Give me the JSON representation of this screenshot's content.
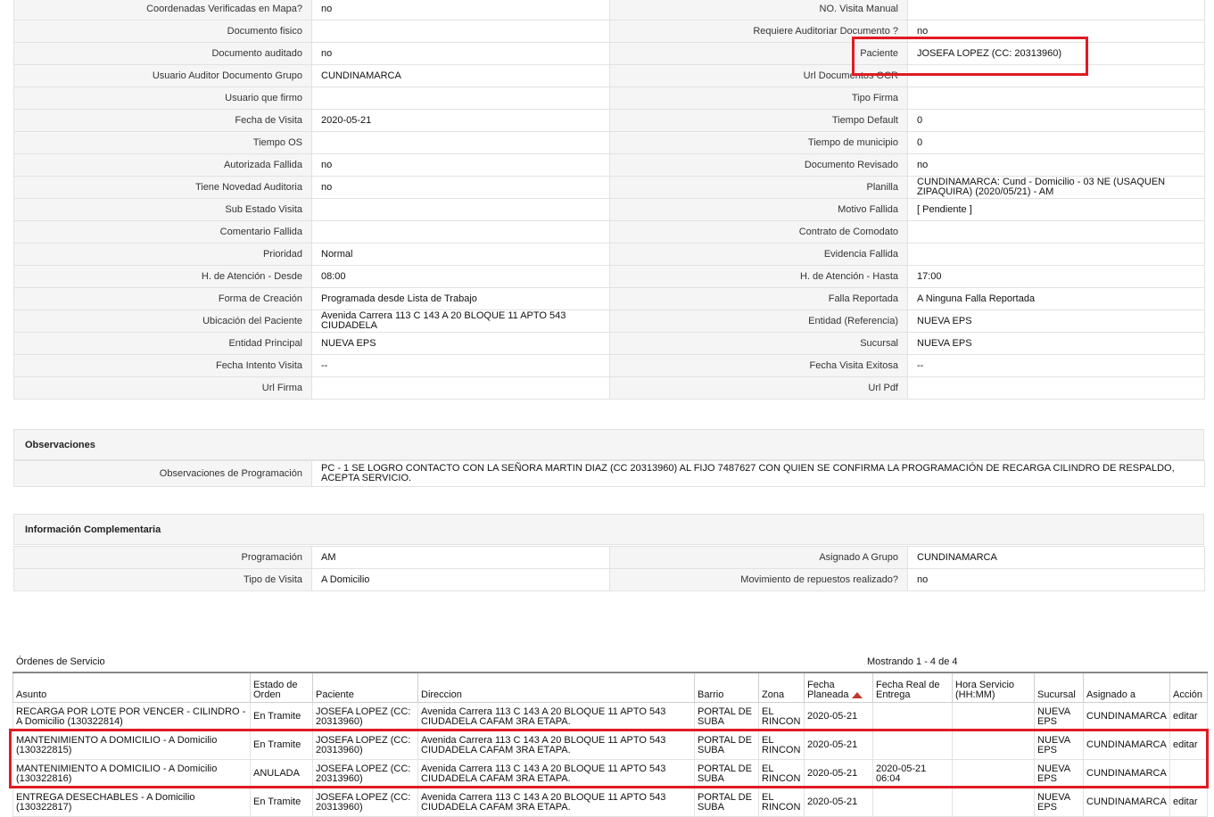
{
  "details": {
    "rows": [
      [
        "Coordenadas Verificadas en Mapa?",
        "no",
        "NO. Visita Manual",
        ""
      ],
      [
        "Documento fisico",
        "",
        "Requiere Auditoriar Documento ?",
        "no"
      ],
      [
        "Documento auditado",
        "no",
        "Paciente",
        "JOSEFA LOPEZ (CC: 20313960)"
      ],
      [
        "Usuario Auditor Documento Grupo",
        "CUNDINAMARCA",
        "Url Documentos OCR",
        ""
      ],
      [
        "Usuario que firmo",
        "",
        "Tipo Firma",
        ""
      ],
      [
        "Fecha de Visita",
        "2020-05-21",
        "Tiempo Default",
        "0"
      ],
      [
        "Tiempo OS",
        "",
        "Tiempo de municipio",
        "0"
      ],
      [
        "Autorizada Fallida",
        "no",
        "Documento Revisado",
        "no"
      ],
      [
        "Tiene Novedad Auditoria",
        "no",
        "Planilla",
        "CUNDINAMARCA: Cund - Domicilio - 03 NE (USAQUEN ZIPAQUIRA) (2020/05/21) - AM"
      ],
      [
        "Sub Estado Visita",
        "",
        "Motivo Fallida",
        "[ Pendiente ]"
      ],
      [
        "Comentario Fallida",
        "",
        "Contrato de Comodato",
        ""
      ],
      [
        "Prioridad",
        "Normal",
        "Evidencia Fallida",
        ""
      ],
      [
        "H. de Atención - Desde",
        "08:00",
        "H. de Atención - Hasta",
        "17:00"
      ],
      [
        "Forma de Creación",
        "Programada desde Lista de Trabajo",
        "Falla Reportada",
        "A Ninguna Falla Reportada"
      ],
      [
        "Ubicación del Paciente",
        "Avenida Carrera 113 C 143 A 20 BLOQUE 11 APTO 543 CIUDADELA",
        "Entidad (Referencia)",
        "NUEVA EPS"
      ],
      [
        "Entidad Principal",
        "NUEVA EPS",
        "Sucursal",
        "NUEVA EPS"
      ],
      [
        "Fecha Intento Visita",
        "--",
        "Fecha Visita Exitosa",
        "--"
      ],
      [
        "Url Firma",
        "",
        "Url Pdf",
        ""
      ]
    ]
  },
  "observaciones": {
    "title": "Observaciones",
    "label": "Observaciones de Programación",
    "value": "PC - 1 SE LOGRO CONTACTO CON LA SEÑORA MARTIN DIAZ (CC 20313960) AL FIJO 7487627 CON QUIEN SE CONFIRMA LA PROGRAMACIÓN DE RECARGA CILINDRO DE RESPALDO, ACEPTA SERVICIO."
  },
  "complementaria": {
    "title": "Información Complementaria",
    "rows": [
      [
        "Programación",
        "AM",
        "Asignado A Grupo",
        "CUNDINAMARCA"
      ],
      [
        "Tipo de Visita",
        "A Domicilio",
        "Movimiento de repuestos realizado?",
        "no"
      ]
    ]
  },
  "orders": {
    "title": "Órdenes de Servicio",
    "count_text": "Mostrando 1 - 4 de 4",
    "headers": [
      "Asunto",
      "Estado de Orden",
      "Paciente",
      "Direccion",
      "Barrio",
      "Zona",
      "Fecha Planeada",
      "Fecha Real de Entrega",
      "Hora Servicio (HH:MM)",
      "Sucursal",
      "Asignado a",
      "Acción"
    ],
    "rows": [
      [
        "RECARGA POR LOTE POR VENCER - CILINDRO - A Domicilio (130322814)",
        "En Tramite",
        "JOSEFA LOPEZ (CC: 20313960)",
        "Avenida Carrera 113 C 143 A 20 BLOQUE 11 APTO 543 CIUDADELA CAFAM 3RA ETAPA.",
        "PORTAL DE SUBA",
        "EL RINCON",
        "2020-05-21",
        "",
        "",
        "NUEVA EPS",
        "CUNDINAMARCA",
        "editar"
      ],
      [
        "MANTENIMIENTO A DOMICILIO - A Domicilio (130322815)",
        "En Tramite",
        "JOSEFA LOPEZ (CC: 20313960)",
        "Avenida Carrera 113 C 143 A 20 BLOQUE 11 APTO 543 CIUDADELA CAFAM 3RA ETAPA.",
        "PORTAL DE SUBA",
        "EL RINCON",
        "2020-05-21",
        "",
        "",
        "NUEVA EPS",
        "CUNDINAMARCA",
        "editar"
      ],
      [
        "MANTENIMIENTO A DOMICILIO - A Domicilio (130322816)",
        "ANULADA",
        "JOSEFA LOPEZ (CC: 20313960)",
        "Avenida Carrera 113 C 143 A 20 BLOQUE 11 APTO 543 CIUDADELA CAFAM 3RA ETAPA.",
        "PORTAL DE SUBA",
        "EL RINCON",
        "2020-05-21",
        "2020-05-21 06:04",
        "",
        "NUEVA EPS",
        "CUNDINAMARCA",
        ""
      ],
      [
        "ENTREGA DESECHABLES - A Domicilio (130322817)",
        "En Tramite",
        "JOSEFA LOPEZ (CC: 20313960)",
        "Avenida Carrera 113 C 143 A 20 BLOQUE 11 APTO 543 CIUDADELA CAFAM 3RA ETAPA.",
        "PORTAL DE SUBA",
        "EL RINCON",
        "2020-05-21",
        "",
        "",
        "NUEVA EPS",
        "CUNDINAMARCA",
        "editar"
      ]
    ]
  },
  "highlight_color": "#e01b24",
  "sort_icon": "sort-asc-icon"
}
